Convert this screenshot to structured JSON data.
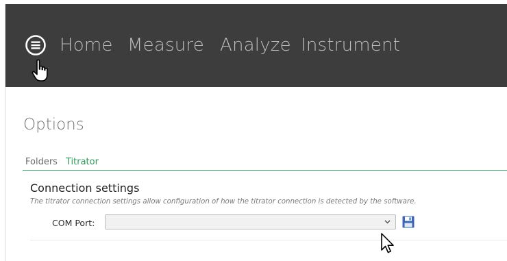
{
  "nav": {
    "items": [
      {
        "label": "Home"
      },
      {
        "label": "Measure"
      },
      {
        "label": "Analyze"
      },
      {
        "label": "Instrument"
      }
    ]
  },
  "page": {
    "title": "Options"
  },
  "tabs": [
    {
      "label": "Folders",
      "active": false
    },
    {
      "label": "Titrator",
      "active": true
    }
  ],
  "connection": {
    "title": "Connection settings",
    "description": "The titrator connection settings allow configuration of how the titrator connection is detected by the software.",
    "com_port_label": "COM Port:",
    "com_port_value": ""
  },
  "colors": {
    "nav_bg": "#3d3d3d",
    "nav_text": "#bcbcbc",
    "accent_green": "#39a35f",
    "save_icon": "#3a67b7"
  },
  "icons": [
    "menu-icon",
    "chevron-down-icon",
    "save-icon",
    "hand-cursor-icon",
    "arrow-cursor-icon"
  ]
}
